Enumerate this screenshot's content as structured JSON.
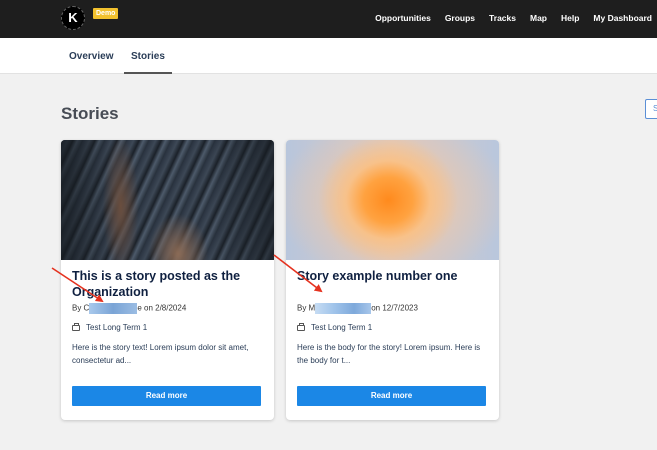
{
  "app": {
    "logo_letter": "K",
    "badge": "Demo"
  },
  "nav": {
    "items": [
      "Opportunities",
      "Groups",
      "Tracks",
      "Map",
      "Help",
      "My Dashboard"
    ]
  },
  "tabs": {
    "overview": "Overview",
    "stories": "Stories",
    "active": "Stories"
  },
  "page": {
    "title": "Stories",
    "edge_button_label": "S"
  },
  "stories": [
    {
      "title": "This is a story posted as the Organization",
      "byline_prefix": "By C",
      "byline_suffix": "e on 2/8/2024",
      "track": "Test Long Term 1",
      "excerpt": "Here is the story text! Lorem ipsum dolor sit amet, consectetur ad...",
      "cta": "Read more",
      "image": "canyon-photo"
    },
    {
      "title": "Story example number one",
      "byline_prefix": "By M",
      "byline_suffix": "on 12/7/2023",
      "track": "Test Long Term 1",
      "excerpt": "Here is the body for the story! Lorem ipsum. Here is the body for t...",
      "cta": "Read more",
      "image": "orange-blur-gradient"
    }
  ],
  "icons": {
    "track": "briefcase-icon"
  },
  "colors": {
    "topbar": "#1e1e1e",
    "badge": "#f2c12e",
    "button": "#1b87e6",
    "title_text": "#0f2040",
    "arrow": "#e5321f"
  }
}
